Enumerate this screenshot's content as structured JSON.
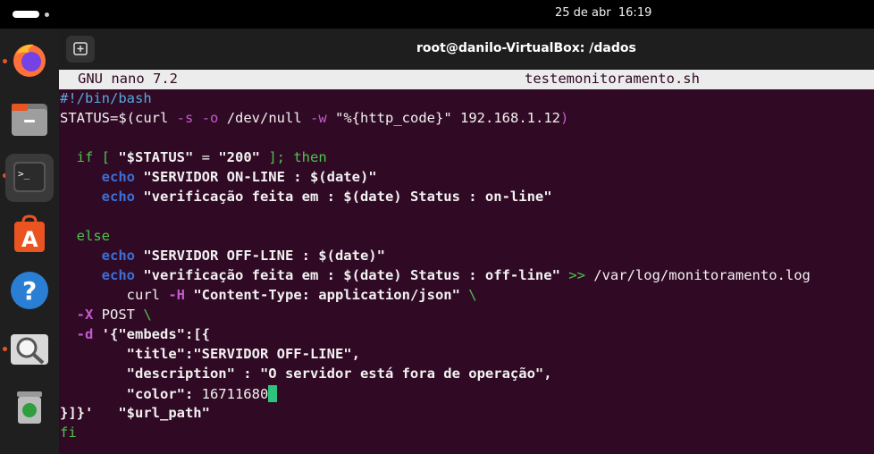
{
  "topbar": {
    "date": "25 de abr",
    "time": "16:19"
  },
  "window": {
    "title": "root@danilo-VirtualBox: /dados"
  },
  "nano": {
    "version": "GNU nano 7.2",
    "filename": "testemonitoramento.sh"
  },
  "dock": [
    "firefox-icon",
    "files-icon",
    "terminal-icon",
    "app-center-icon",
    "help-icon",
    "image-viewer-icon",
    "trash-icon"
  ],
  "code": {
    "l1": "#!/bin/bash",
    "l2a": "STATUS=$(",
    "l2b": "curl ",
    "l2c": "-s",
    "l2d": " ",
    "l2e": "-o",
    "l2f": " /dev/null ",
    "l2g": "-w",
    "l2h": " \"%{http_code}\"",
    "l2i": " 192.168.1.12",
    "l2j": ")",
    "l4a": "  if [ ",
    "l4b": "\"$STATUS\"",
    "l4c": " = ",
    "l4d": "\"200\"",
    "l4e": " ]; then",
    "l5a": "     echo",
    "l5b": " \"SERVIDOR ON-LINE : $(date)\"",
    "l6a": "     echo",
    "l6b": " \"verificação feita em : $(date) Status : on-line\"",
    "l8": "  else",
    "l9a": "     echo",
    "l9b": " \"SERVIDOR OFF-LINE : $(date)\"",
    "l10a": "     echo",
    "l10b": " \"verificação feita em : $(date) Status : off-line\"",
    "l10c": " >>",
    "l10d": " /var/log/monitoramento.log",
    "l11a": "        curl ",
    "l11b": "-H",
    "l11c": " \"Content-Type: application/json\"",
    "l11d": " \\",
    "l12a": "  -X",
    "l12b": " POST ",
    "l12c": "\\",
    "l13a": "  -d",
    "l13b": " '{\"embeds\":[{",
    "l14": "        \"title\":\"SERVIDOR OFF-LINE\",",
    "l15": "        \"description\" : \"O servidor está fora de operação\",",
    "l16a": "        \"color\": ",
    "l16b": "16711680",
    "l17a": "}]}'",
    "l17b": "   \"$url_path\"",
    "l18": "fi"
  }
}
